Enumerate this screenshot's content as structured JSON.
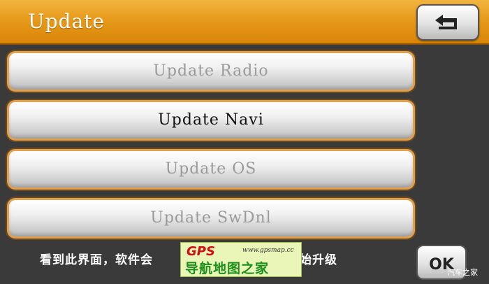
{
  "header": {
    "title": "Update",
    "back_icon": "back-arrow-icon"
  },
  "menu": {
    "items": [
      {
        "label": "Update Radio",
        "state": "disabled"
      },
      {
        "label": "Update Navi",
        "state": "enabled"
      },
      {
        "label": "Update OS",
        "state": "disabled"
      },
      {
        "label": "Update SwDnl",
        "state": "disabled"
      }
    ]
  },
  "footer": {
    "status_left": "看到此界面，软件会",
    "status_right": "开始升级",
    "ok_label": "OK"
  },
  "watermark": {
    "logo": "GPS",
    "url": "www.gpsmap.cc",
    "text": "导航地图之家"
  },
  "corner_mark": "汽车之家",
  "colors": {
    "header_orange": "#e79a1a",
    "button_border_orange": "#e0a050",
    "background": "#3a3a3a"
  }
}
